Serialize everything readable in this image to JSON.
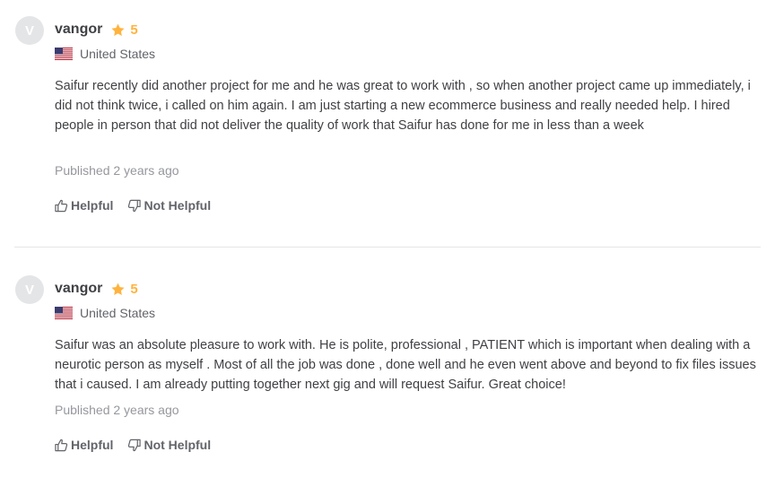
{
  "reviews": [
    {
      "avatar_initial": "V",
      "username": "vangor",
      "rating": "5",
      "country": "United States",
      "text": "Saifur recently did another project for me and he was great to work with , so when another project came up immediately, i did not think twice, i called on him again. I am just starting a new ecommerce business and really needed help. I hired people in person that did not deliver the quality of work that Saifur has done for me in less than a week",
      "published": "Published 2 years ago",
      "helpful_label": "Helpful",
      "not_helpful_label": "Not Helpful"
    },
    {
      "avatar_initial": "V",
      "username": "vangor",
      "rating": "5",
      "country": "United States",
      "text": "Saifur was an absolute pleasure to work with. He is polite, professional , PATIENT which is important when dealing with a neurotic person as myself . Most of all the job was done , done well and he even went above and beyond to fix files issues that i caused. I am already putting together next gig and will request Saifur. Great choice!",
      "published": "Published 2 years ago",
      "helpful_label": "Helpful",
      "not_helpful_label": "Not Helpful"
    }
  ],
  "colors": {
    "star": "#ffb33e",
    "text": "#404145",
    "muted": "#95979d",
    "avatar_bg": "#e4e5e7"
  },
  "icons": {
    "star": "star-icon",
    "flag": "us-flag-icon",
    "helpful": "thumbs-up-icon",
    "not_helpful": "thumbs-down-icon"
  }
}
